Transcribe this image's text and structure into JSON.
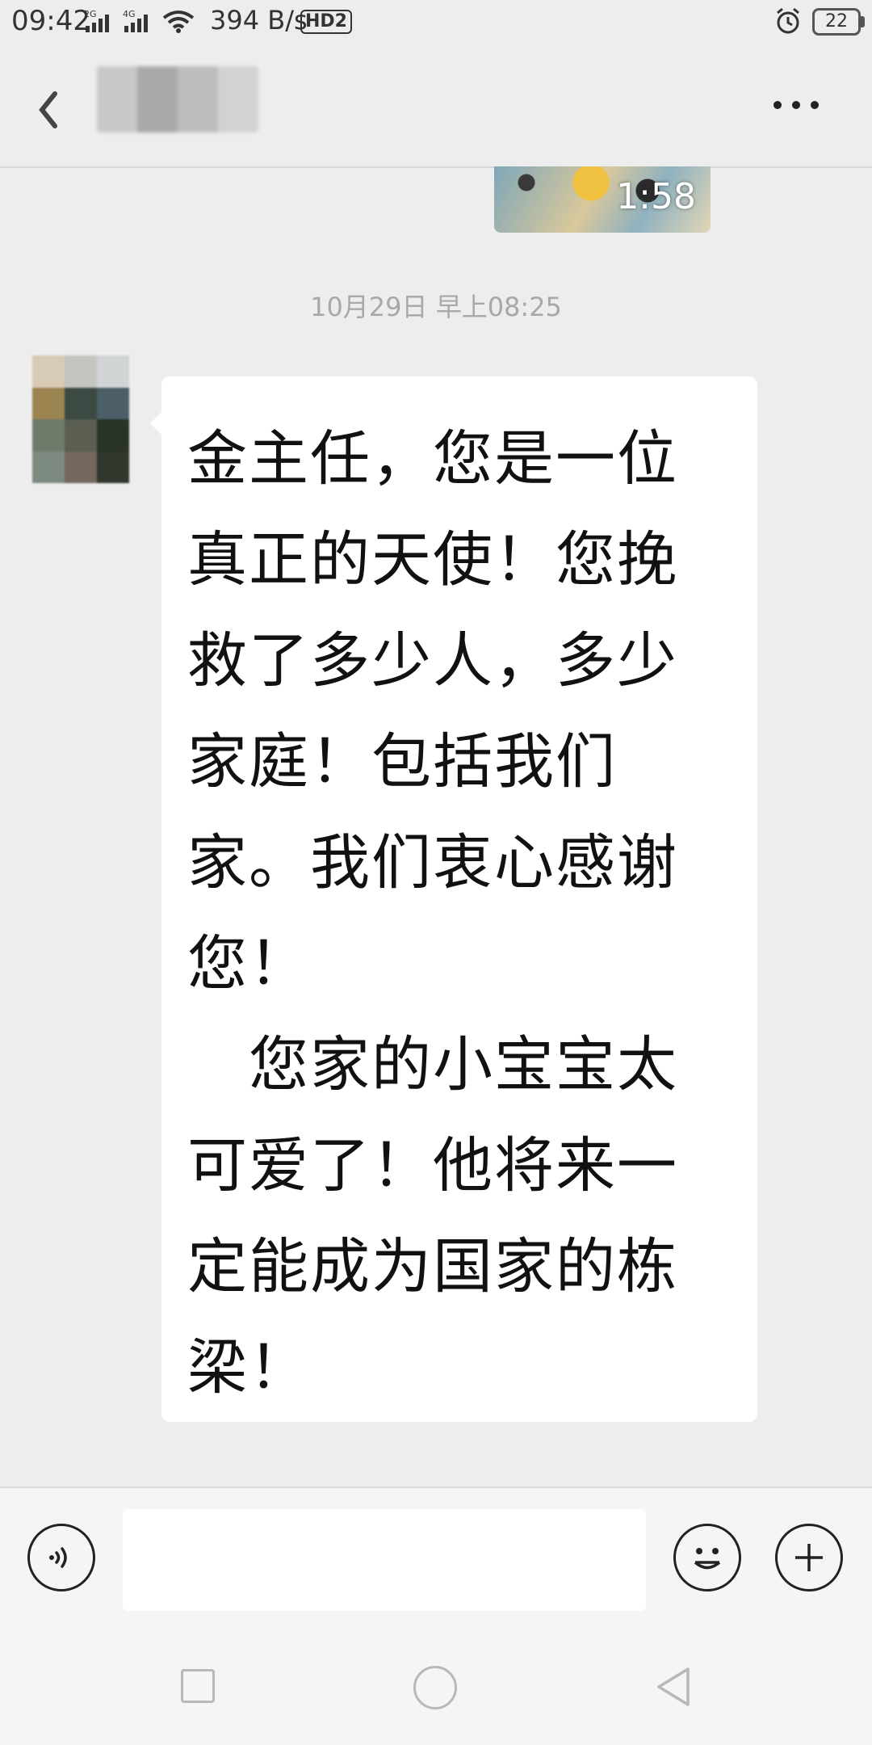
{
  "status_bar": {
    "time": "09:42",
    "signal_1": "2G",
    "signal_2": "4G",
    "network_speed": "394 B/s",
    "hd_label": "HD2",
    "battery": "22"
  },
  "header": {
    "contact_name": "",
    "back_icon": "chevron-left-icon",
    "more_icon": "more-dots-icon"
  },
  "video_message": {
    "duration": "1:58"
  },
  "timestamp": "10月29日 早上08:25",
  "message": {
    "lines": [
      "金主任，您是一位",
      "真正的天使！您挽",
      "救了多少人，多少",
      "家庭！包括我们",
      "家。我们衷心感谢",
      "您！",
      "　您家的小宝宝太",
      "可爱了！他将来一",
      "定能成为国家的栋",
      "梁！"
    ]
  },
  "input_bar": {
    "voice_icon": "voice-icon",
    "emoji_icon": "emoji-icon",
    "plus_icon": "plus-icon",
    "input_value": ""
  },
  "nav_bar": {
    "recents_icon": "square-icon",
    "home_icon": "circle-icon",
    "back_icon": "triangle-back-icon"
  }
}
